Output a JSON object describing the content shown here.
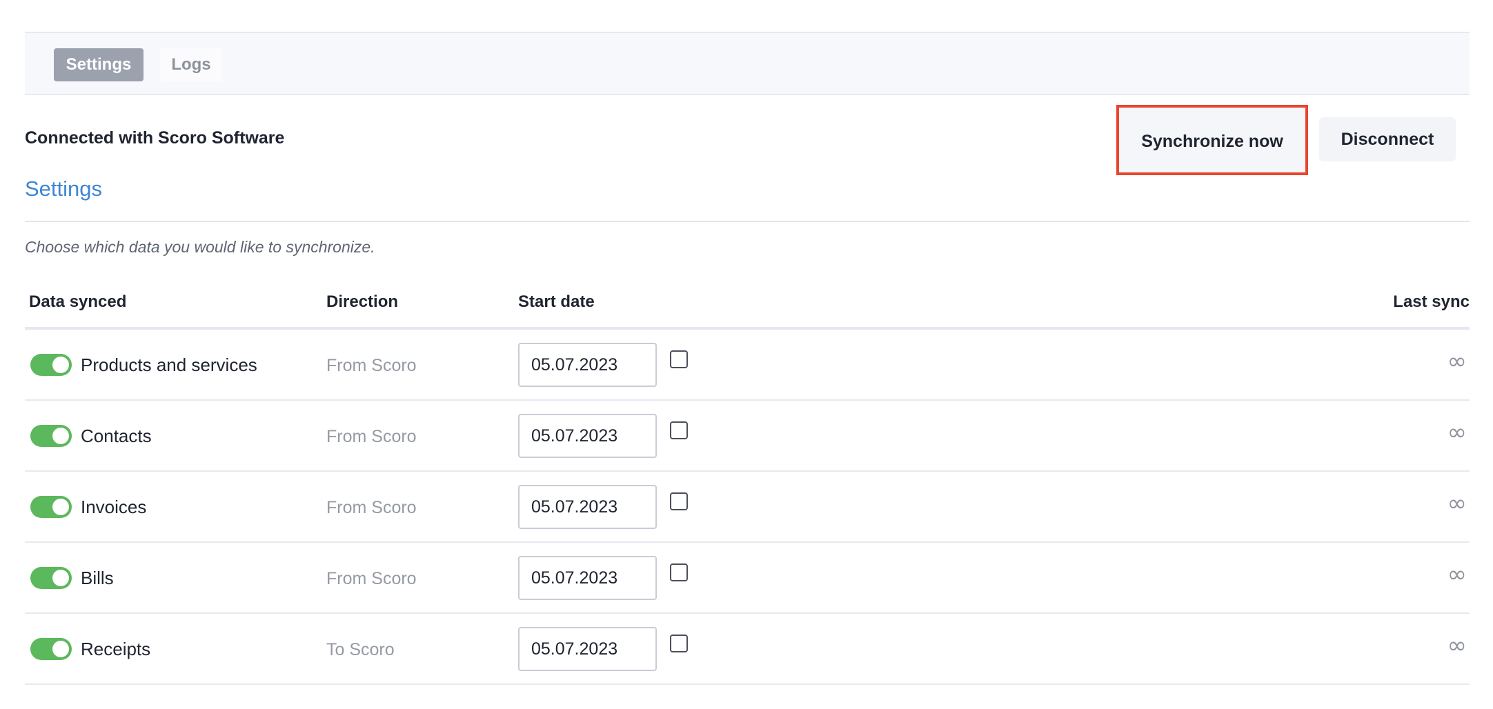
{
  "tabs": [
    {
      "label": "Settings",
      "active": true
    },
    {
      "label": "Logs",
      "active": false
    }
  ],
  "header": {
    "connection_status": "Connected with Scoro Software",
    "sync_button": "Synchronize now",
    "disconnect_button": "Disconnect"
  },
  "settings": {
    "title": "Settings",
    "hint": "Choose which data you would like to synchronize."
  },
  "table": {
    "columns": {
      "data": "Data synced",
      "direction": "Direction",
      "start_date": "Start date",
      "last_sync": "Last sync"
    },
    "rows": [
      {
        "label": "Products and services",
        "direction": "From Scoro",
        "start_date": "05.07.2023",
        "enabled": true,
        "checked": false,
        "last_sync": "∞"
      },
      {
        "label": "Contacts",
        "direction": "From Scoro",
        "start_date": "05.07.2023",
        "enabled": true,
        "checked": false,
        "last_sync": "∞"
      },
      {
        "label": "Invoices",
        "direction": "From Scoro",
        "start_date": "05.07.2023",
        "enabled": true,
        "checked": false,
        "last_sync": "∞"
      },
      {
        "label": "Bills",
        "direction": "From Scoro",
        "start_date": "05.07.2023",
        "enabled": true,
        "checked": false,
        "last_sync": "∞"
      },
      {
        "label": "Receipts",
        "direction": "To Scoro",
        "start_date": "05.07.2023",
        "enabled": true,
        "checked": false,
        "last_sync": "∞"
      }
    ]
  },
  "colors": {
    "accent": "#3b86d6",
    "toggle_on": "#5cb85c",
    "highlight": "#e8442e",
    "active_tab": "#9ba1ad"
  },
  "icons": {
    "last_sync": "infinity-icon"
  }
}
